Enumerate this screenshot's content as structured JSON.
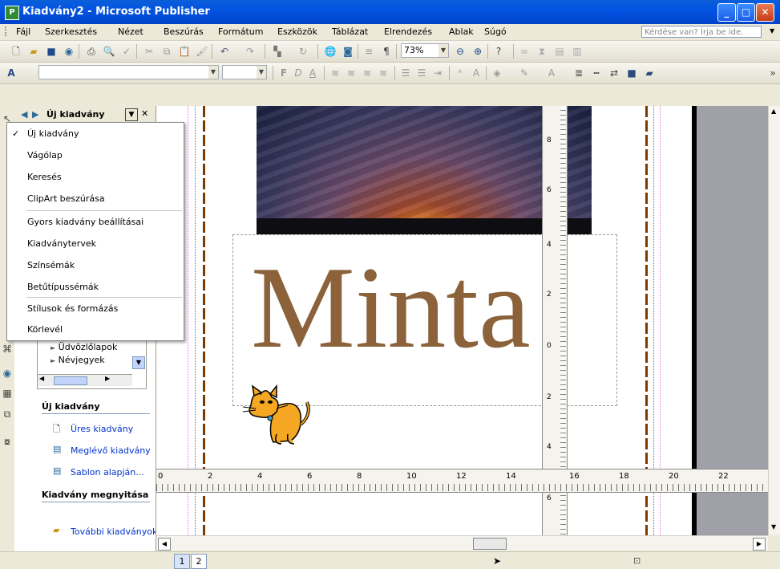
{
  "window": {
    "title": "Kiadvány2 - Microsoft Publisher",
    "app_icon_letter": "P",
    "controls": {
      "minimize": "_",
      "maximize": "□",
      "close": "✕"
    }
  },
  "menu": {
    "items": [
      "Fájl",
      "Szerkesztés",
      "Nézet",
      "Beszúrás",
      "Formátum",
      "Eszközök",
      "Táblázat",
      "Elrendezés",
      "Ablak",
      "Súgó"
    ],
    "help_placeholder": "Kérdése van? Írja be ide."
  },
  "toolbar_standard": {
    "zoom": "73%"
  },
  "toolbar_format": {
    "font_name": "",
    "font_size": "",
    "bold": "F",
    "italic": "D",
    "underline": "A"
  },
  "taskpane": {
    "title": "Új kiadvány",
    "dropdown_items": [
      {
        "label": "Új kiadvány",
        "checked": true
      },
      {
        "label": "Vágólap",
        "checked": false
      },
      {
        "label": "Keresés",
        "checked": false
      },
      {
        "label": "ClipArt beszúrása",
        "checked": false
      },
      {
        "label": "Gyors kiadvány beállításai",
        "checked": false
      },
      {
        "label": "Kiadványtervek",
        "checked": false
      },
      {
        "label": "Színsémák",
        "checked": false
      },
      {
        "label": "Betűtípussémák",
        "checked": false
      },
      {
        "label": "Stílusok és formázás",
        "checked": false
      },
      {
        "label": "Körlevél",
        "checked": false
      }
    ],
    "tree_items": [
      "Üdvözlőlapok",
      "Névjegyek"
    ],
    "new_section_title": "Új kiadvány",
    "new_links": [
      "Üres kiadvány",
      "Meglévő kiadvány",
      "Sablon alapján..."
    ],
    "open_section_title": "Kiadvány megnyitása",
    "open_links": [
      "További kiadványok..."
    ]
  },
  "document": {
    "heading_text": "Minta",
    "heading_color": "#8b6239"
  },
  "rulers": {
    "horizontal_labels": [
      "0",
      "2",
      "4",
      "6",
      "8",
      "10",
      "12",
      "14",
      "16",
      "18",
      "20",
      "22"
    ],
    "vertical_labels": [
      "8",
      "6",
      "4",
      "2",
      "0",
      "2",
      "4",
      "6"
    ]
  },
  "statusbar": {
    "pages": [
      "1",
      "2"
    ]
  }
}
